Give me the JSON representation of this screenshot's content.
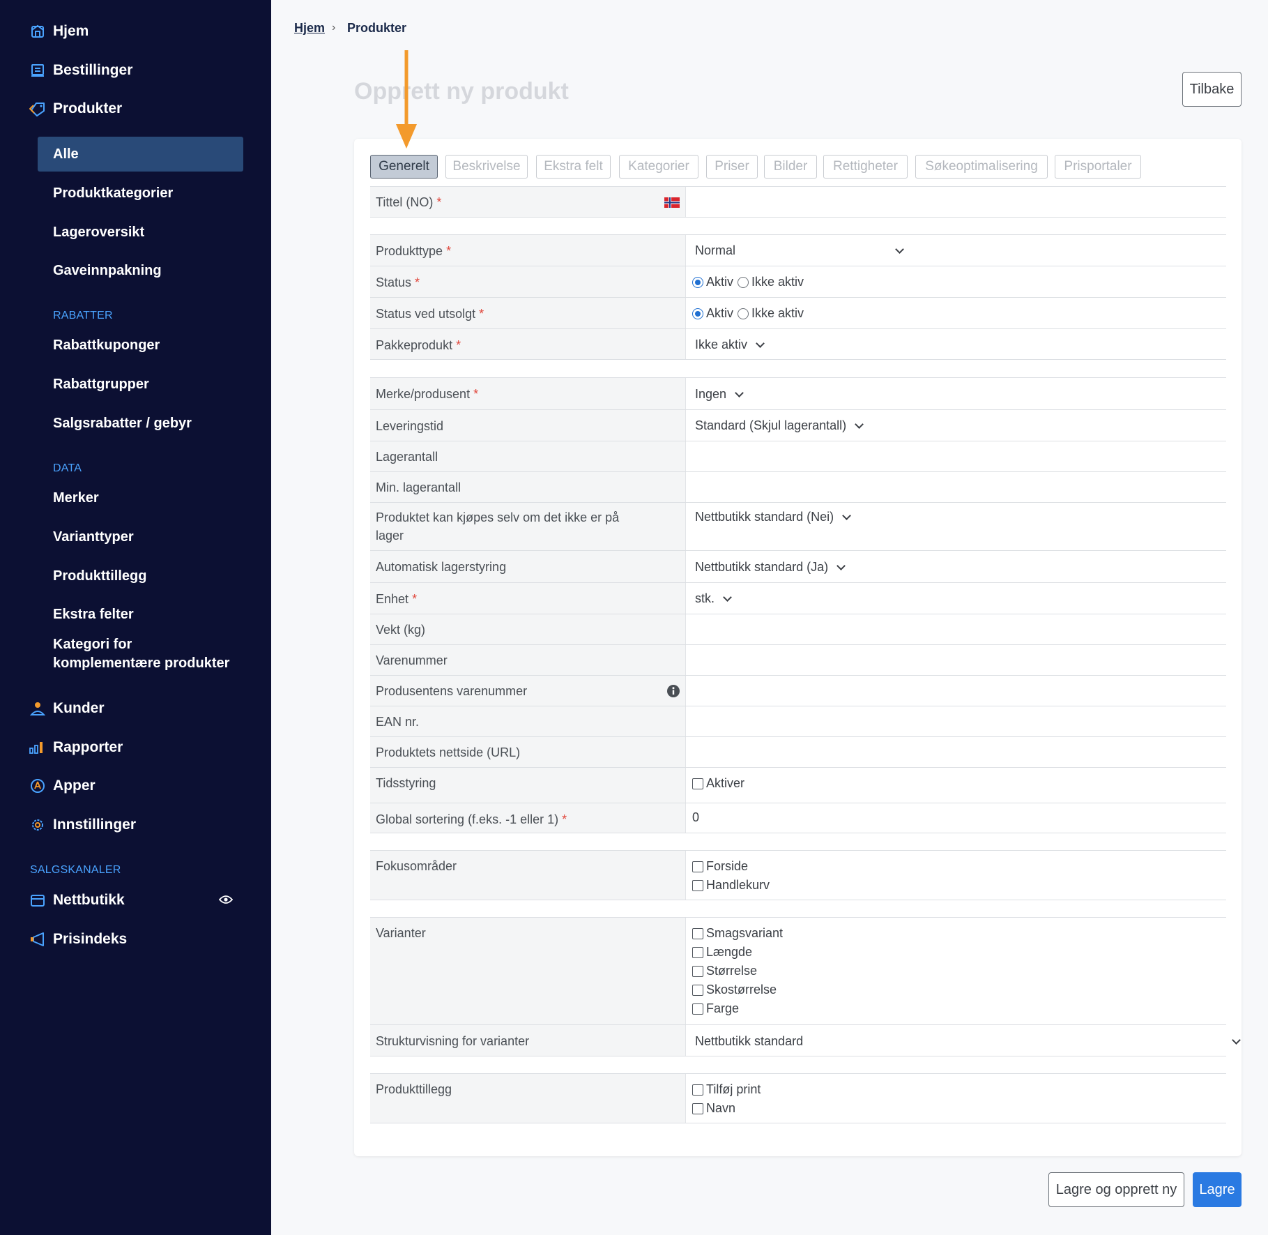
{
  "sidebar": {
    "items": [
      {
        "label": "Hjem",
        "icon": "home-icon"
      },
      {
        "label": "Bestillinger",
        "icon": "orders-icon"
      },
      {
        "label": "Produkter",
        "icon": "tag-icon"
      }
    ],
    "product_sub": [
      "Alle",
      "Produktkategorier",
      "Lageroversikt",
      "Gaveinnpakning"
    ],
    "rabatter_head": "RABATTER",
    "rabatter": [
      "Rabattkuponger",
      "Rabattgrupper",
      "Salgsrabatter / gebyr"
    ],
    "data_head": "DATA",
    "data": [
      "Merker",
      "Varianttyper",
      "Produkttillegg",
      "Ekstra felter",
      "Kategori for",
      "komplementære produkter"
    ],
    "main2": [
      {
        "label": "Kunder",
        "icon": "user-icon"
      },
      {
        "label": "Rapporter",
        "icon": "chart-icon"
      },
      {
        "label": "Apper",
        "icon": "apps-icon"
      },
      {
        "label": "Innstillinger",
        "icon": "gear-icon"
      }
    ],
    "channels_head": "SALGSKANALER",
    "channels": [
      {
        "label": "Nettbutikk",
        "icon": "store-icon"
      },
      {
        "label": "Prisindeks",
        "icon": "megaphone-icon"
      }
    ],
    "accent": "#4aa3ff",
    "active_bg": "#294a78"
  },
  "breadcrumb": {
    "home": "Hjem",
    "sep": "›",
    "current": "Produkter"
  },
  "page": {
    "title": "Opprett ny produkt",
    "back": "Tilbake"
  },
  "tabs": [
    "Generelt",
    "Beskrivelse",
    "Ekstra felt",
    "Kategorier",
    "Priser",
    "Bilder",
    "Rettigheter",
    "Søkeoptimalisering",
    "Prisportaler"
  ],
  "form": {
    "title_label": "Tittel (NO)",
    "produkttype": {
      "label": "Produkttype",
      "value": "Normal"
    },
    "status": {
      "label": "Status",
      "opt1": "Aktiv",
      "opt2": "Ikke aktiv"
    },
    "status_utsolgt": {
      "label": "Status ved utsolgt",
      "opt1": "Aktiv",
      "opt2": "Ikke aktiv"
    },
    "pakkeprodukt": {
      "label": "Pakkeprodukt",
      "value": "Ikke aktiv"
    },
    "merke": {
      "label": "Merke/produsent",
      "value": "Ingen"
    },
    "leveringstid": {
      "label": "Leveringstid",
      "value": "Standard (Skjul lagerantall)"
    },
    "lagerantall": {
      "label": "Lagerantall"
    },
    "min_lager": {
      "label": "Min. lagerantall"
    },
    "kjopes": {
      "label1": "Produktet kan kjøpes selv om det ikke er på",
      "label2": "lager",
      "value": "Nettbutikk standard (Nei)"
    },
    "auto_lager": {
      "label": "Automatisk lagerstyring",
      "value": "Nettbutikk standard (Ja)"
    },
    "enhet": {
      "label": "Enhet",
      "value": "stk."
    },
    "vekt": {
      "label": "Vekt (kg)"
    },
    "varenummer": {
      "label": "Varenummer"
    },
    "prod_varenummer": {
      "label": "Produsentens varenummer"
    },
    "ean": {
      "label": "EAN nr."
    },
    "nettside": {
      "label": "Produktets nettside (URL)"
    },
    "tidsstyring": {
      "label": "Tidsstyring",
      "option": "Aktiver"
    },
    "sortering": {
      "label": "Global sortering (f.eks. -1 eller 1)",
      "value": "0"
    },
    "fokus": {
      "label": "Fokusområder",
      "options": [
        "Forside",
        "Handlekurv"
      ]
    },
    "varianter": {
      "label": "Varianter",
      "options": [
        "Smagsvariant",
        "Længde",
        "Størrelse",
        "Skostørrelse",
        "Farge"
      ]
    },
    "struktur": {
      "label": "Strukturvisning for varianter",
      "value": "Nettbutikk standard"
    },
    "tillegg": {
      "label": "Produkttillegg",
      "options": [
        "Tilføj print",
        "Navn"
      ]
    },
    "required_mark": "*"
  },
  "actions": {
    "save_new": "Lagre og opprett ny",
    "save": "Lagre"
  },
  "colors": {
    "primary": "#2a7ae2",
    "arrow": "#f39a2c",
    "sidebar": "#0c1033"
  }
}
